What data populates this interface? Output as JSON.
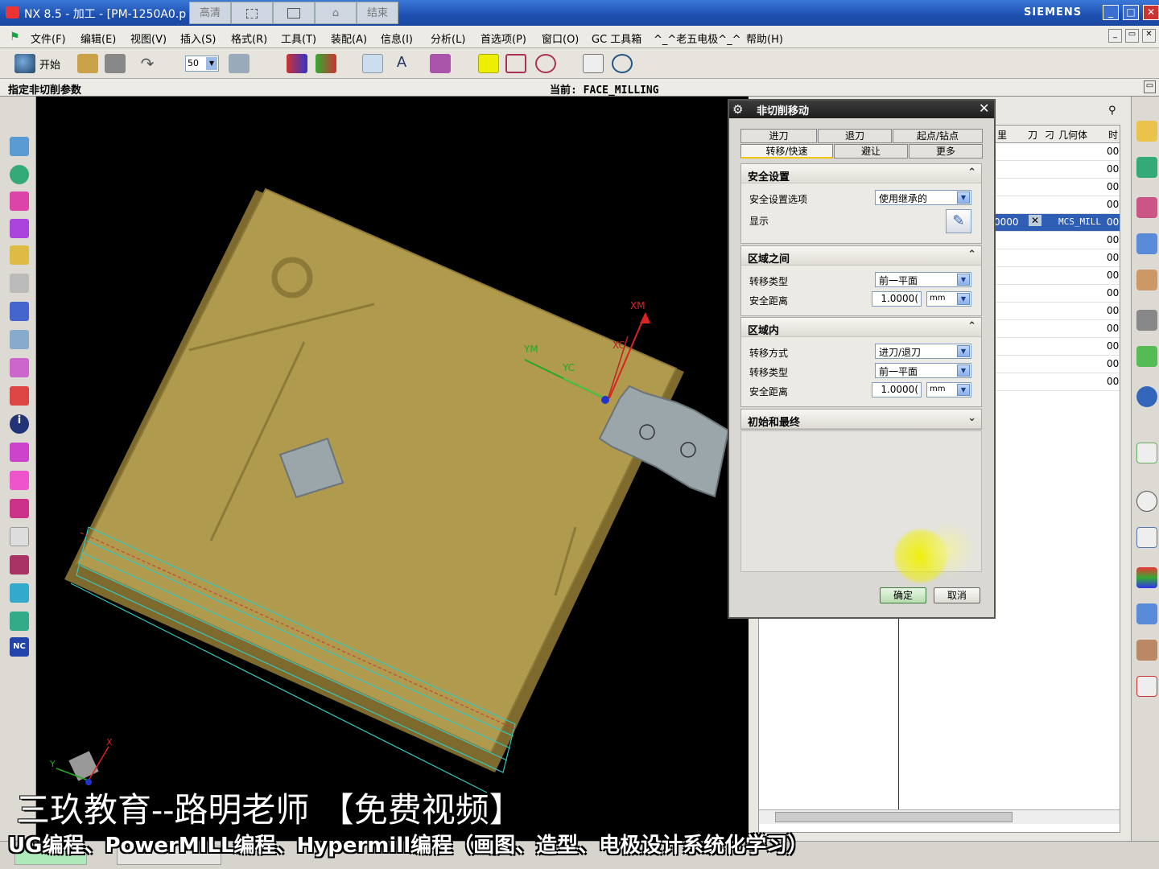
{
  "window": {
    "title": "NX 8.5 - 加工 - [PM-1250A0.p",
    "title_tabs": [
      "高清",
      "",
      "",
      "",
      "结束"
    ],
    "brand": "SIEMENS",
    "controls": [
      "_",
      "□",
      "✕"
    ]
  },
  "menubar": {
    "items": [
      "文件(F)",
      "编辑(E)",
      "视图(V)",
      "插入(S)",
      "格式(R)",
      "工具(T)",
      "装配(A)",
      "信息(I)",
      "分析(L)",
      "首选项(P)",
      "窗口(O)",
      "GC 工具箱",
      "^_^老五电极^_^",
      "帮助(H)"
    ]
  },
  "toolbar": {
    "start_label": "开始",
    "zoom_value": "50"
  },
  "cue": {
    "prompt": "指定非切削参数",
    "current": "当前: FACE_MILLING"
  },
  "navigator": {
    "headers": [
      "里",
      "刀",
      "刁",
      "几何体",
      "时"
    ],
    "selected_row": {
      "col1": "0000",
      "geometry": "MCS_MILL",
      "time": "00"
    },
    "time_values": [
      "00",
      "00",
      "00",
      "00",
      "00",
      "00",
      "00",
      "00",
      "00",
      "00",
      "00",
      "00",
      "00",
      "00"
    ]
  },
  "viewport": {
    "axis_labels": {
      "xm": "XM",
      "ym": "YM",
      "yc": "YC",
      "xc": "XC",
      "x": "X",
      "y": "Y"
    }
  },
  "dialog": {
    "title": "非切削移动",
    "tabs_row1": [
      "进刀",
      "退刀",
      "起点/钻点"
    ],
    "tabs_row2": [
      "转移/快速",
      "避让",
      "更多"
    ],
    "active_tab": "转移/快速",
    "sections": {
      "safety": {
        "title": "安全设置",
        "option_label": "安全设置选项",
        "option_value": "使用继承的",
        "display_label": "显示"
      },
      "between": {
        "title": "区域之间",
        "type_label": "转移类型",
        "type_value": "前一平面",
        "dist_label": "安全距离",
        "dist_value": "1.0000(",
        "dist_unit": "mm"
      },
      "within": {
        "title": "区域内",
        "method_label": "转移方式",
        "method_value": "进刀/退刀",
        "type_label": "转移类型",
        "type_value": "前一平面",
        "dist_label": "安全距离",
        "dist_value": "1.0000(",
        "dist_unit": "mm"
      },
      "initial": {
        "title": "初始和最终"
      }
    },
    "ok_label": "确定",
    "cancel_label": "取消"
  },
  "overlay": {
    "line1": "三玖教育--路明老师  【免费视频】",
    "line2": "UG编程、PowerMILL编程、Hypermill编程（画图、造型、电极设计系统化学习）"
  },
  "colors": {
    "part": "#b09a4e",
    "part_edge": "#7d6a2c",
    "fixture": "#9aa6aa",
    "toolpath": "#35c7c0",
    "titlebar": "#1d4fb0"
  }
}
